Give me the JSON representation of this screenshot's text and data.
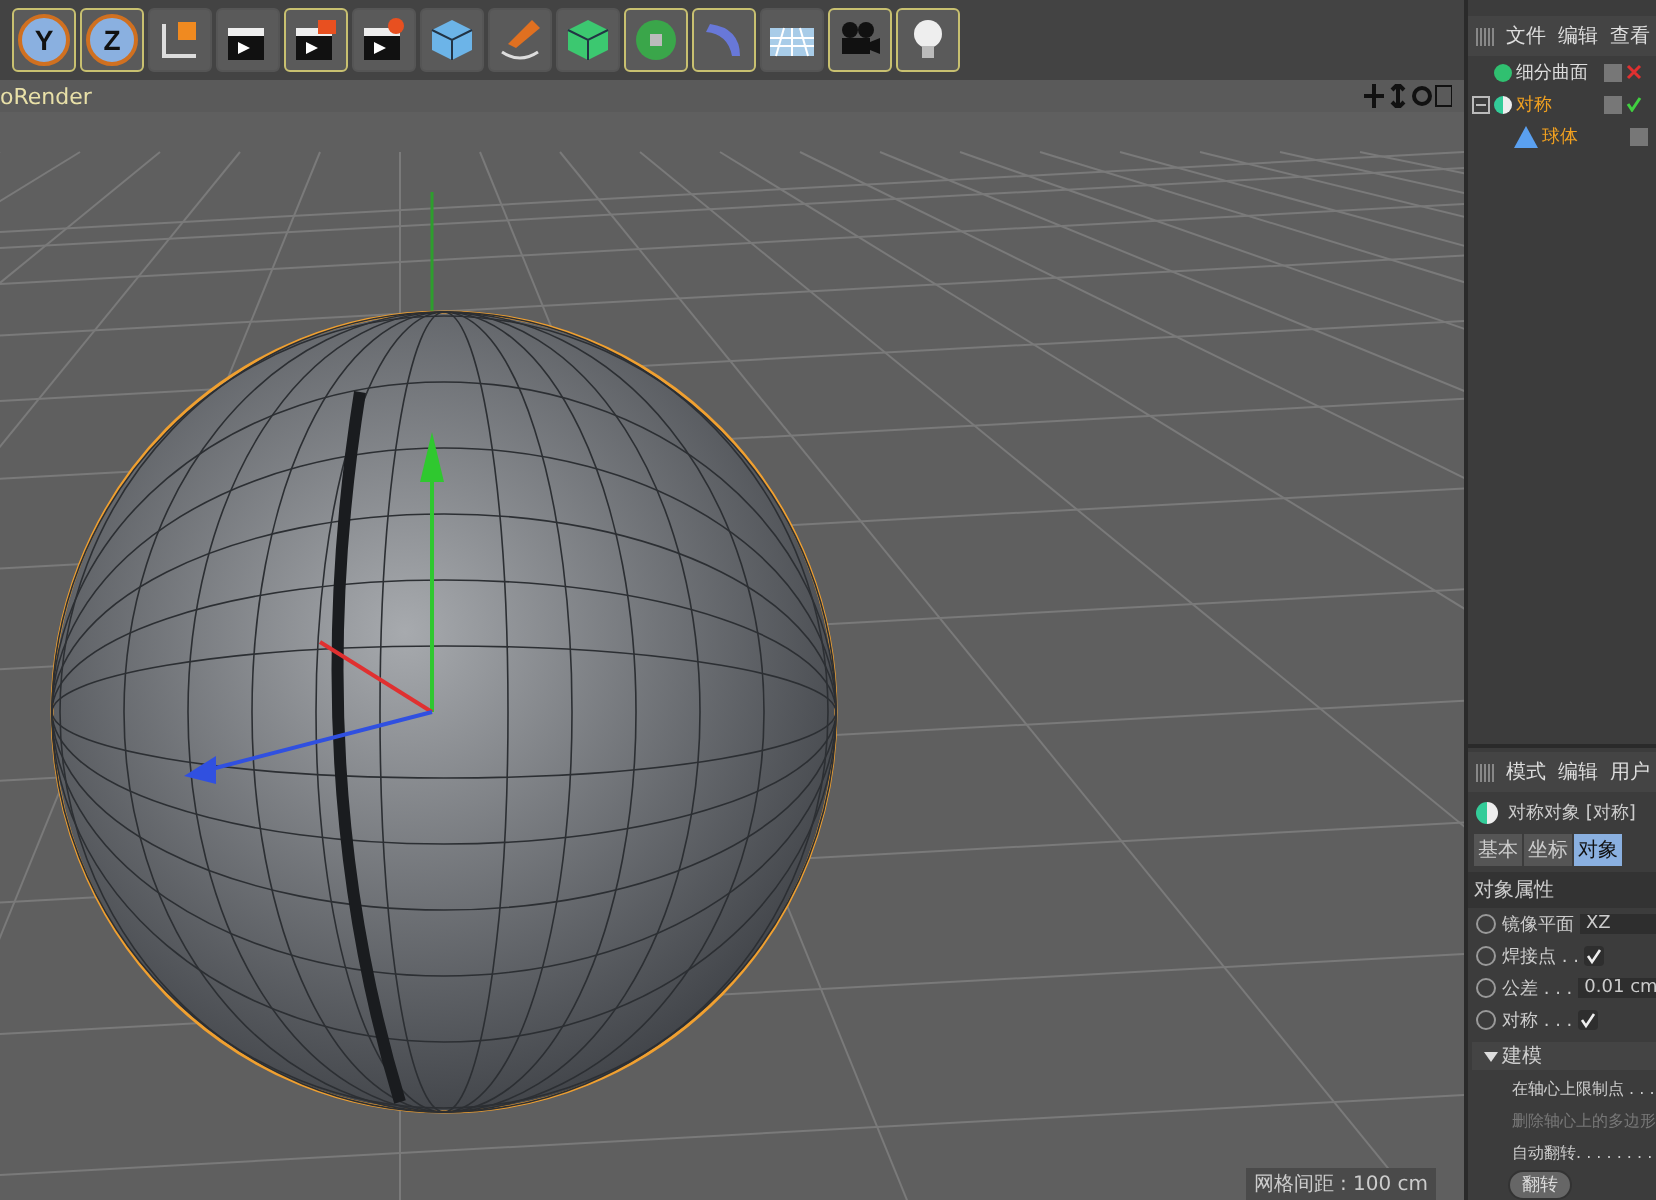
{
  "toolbar": [
    {
      "kind": "axis",
      "label": "Y",
      "selected": true
    },
    {
      "kind": "axis",
      "label": "Z",
      "selected": true
    },
    {
      "kind": "coords",
      "selected": false
    },
    {
      "kind": "clapper",
      "selected": false
    },
    {
      "kind": "clapper-edit",
      "selected": true
    },
    {
      "kind": "clapper-gear",
      "selected": false
    },
    {
      "kind": "cube",
      "selected": false
    },
    {
      "kind": "pen",
      "selected": false
    },
    {
      "kind": "cube-green",
      "selected": false
    },
    {
      "kind": "flower",
      "selected": true
    },
    {
      "kind": "deformer",
      "selected": true
    },
    {
      "kind": "floor",
      "selected": false
    },
    {
      "kind": "camera",
      "selected": true
    },
    {
      "kind": "bulb",
      "selected": true
    }
  ],
  "viewport": {
    "title": "oRender",
    "grid_label": "网格间距 : 100 cm"
  },
  "object_manager": {
    "menu": [
      "文件",
      "编辑",
      "查看"
    ],
    "objects": [
      {
        "name": "细分曲面",
        "kind": "subdiv",
        "selected": false,
        "enabled": false
      },
      {
        "name": "对称",
        "kind": "symmetry",
        "selected": true,
        "enabled": true,
        "expanded": true,
        "children": [
          {
            "name": "球体",
            "kind": "sphere",
            "selected": true
          }
        ]
      }
    ]
  },
  "attributes": {
    "menu": [
      "模式",
      "编辑",
      "用户"
    ],
    "object_title": "对称对象 [对称]",
    "tabs": [
      {
        "label": "基本",
        "selected": false
      },
      {
        "label": "坐标",
        "selected": false
      },
      {
        "label": "对象",
        "selected": true
      }
    ],
    "section": "对象属性",
    "fields": [
      {
        "kind": "dropdown",
        "label": "镜像平面",
        "value": "XZ",
        "animated": false
      },
      {
        "kind": "checkbox",
        "label": "焊接点 . .",
        "checked": true,
        "animated": false
      },
      {
        "kind": "number",
        "label": "公差 . . .",
        "value": "0.01 cm",
        "animated": false
      },
      {
        "kind": "checkbox",
        "label": "对称 . . .",
        "checked": true,
        "animated": false
      }
    ],
    "group": {
      "label": "建模",
      "expanded": true,
      "rows": [
        {
          "label": "在轴心上限制点 . . .",
          "disabled": false
        },
        {
          "label": "删除轴心上的多边形",
          "disabled": true
        },
        {
          "label": "自动翻转. . . . . . . .",
          "disabled": false
        }
      ],
      "button": "翻转"
    }
  }
}
